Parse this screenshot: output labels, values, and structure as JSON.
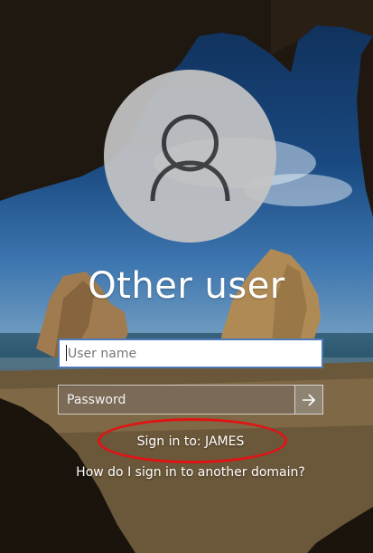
{
  "login": {
    "title": "Other user",
    "username_placeholder": "User name",
    "username_value": "",
    "password_placeholder": "Password",
    "password_value": "",
    "submit_icon": "arrow-right-icon",
    "sign_in_to": "Sign in to: JAMES",
    "other_domain_link": "How do I sign in to another domain?",
    "avatar_icon": "user-icon"
  },
  "colors": {
    "highlight": "#e01414",
    "field_focus_border": "#4f7ab5",
    "text": "#ffffff"
  }
}
